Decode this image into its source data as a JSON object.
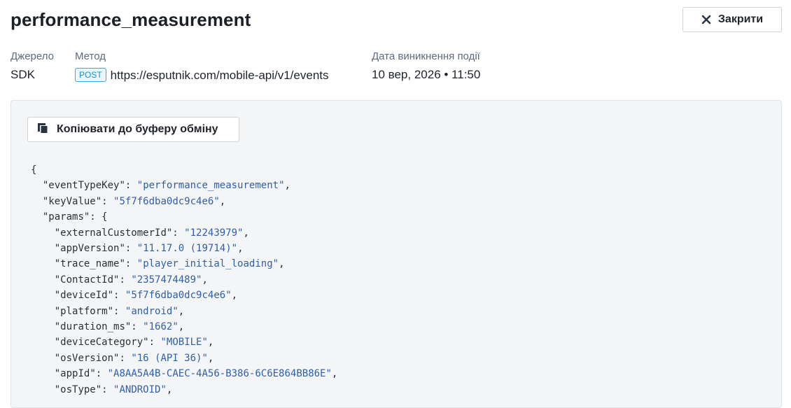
{
  "header": {
    "title": "performance_measurement",
    "close_label": "Закрити",
    "close_icon": "close-icon"
  },
  "meta": {
    "source_label": "Джерело",
    "source_value": "SDK",
    "method_label": "Метод",
    "method_badge": "POST",
    "method_url": "https://esputnik.com/mobile-api/v1/events",
    "date_label": "Дата виникнення події",
    "date_value": "10 вер, 2026 • 11:50"
  },
  "panel": {
    "copy_label": "Копіювати до буферу обміну",
    "copy_icon": "copy-icon",
    "json_lines": [
      {
        "indent": 0,
        "key": "",
        "value": "",
        "suffix": "{"
      },
      {
        "indent": 1,
        "key": "eventTypeKey",
        "value": "performance_measurement",
        "suffix": ","
      },
      {
        "indent": 1,
        "key": "keyValue",
        "value": "5f7f6dba0dc9c4e6",
        "suffix": ","
      },
      {
        "indent": 1,
        "key": "params",
        "value": "",
        "suffix": "{"
      },
      {
        "indent": 2,
        "key": "externalCustomerId",
        "value": "12243979",
        "suffix": ","
      },
      {
        "indent": 2,
        "key": "appVersion",
        "value": "11.17.0 (19714)",
        "suffix": ","
      },
      {
        "indent": 2,
        "key": "trace_name",
        "value": "player_initial_loading",
        "suffix": ","
      },
      {
        "indent": 2,
        "key": "ContactId",
        "value": "2357474489",
        "suffix": ","
      },
      {
        "indent": 2,
        "key": "deviceId",
        "value": "5f7f6dba0dc9c4e6",
        "suffix": ","
      },
      {
        "indent": 2,
        "key": "platform",
        "value": "android",
        "suffix": ","
      },
      {
        "indent": 2,
        "key": "duration_ms",
        "value": "1662",
        "suffix": ","
      },
      {
        "indent": 2,
        "key": "deviceCategory",
        "value": "MOBILE",
        "suffix": ","
      },
      {
        "indent": 2,
        "key": "osVersion",
        "value": "16 (API 36)",
        "suffix": ","
      },
      {
        "indent": 2,
        "key": "appId",
        "value": "A8AA5A4B-CAEC-4A56-B386-6C6E864BB86E",
        "suffix": ","
      },
      {
        "indent": 2,
        "key": "osType",
        "value": "ANDROID",
        "suffix": ","
      }
    ]
  },
  "colors": {
    "json_string": "#2f5fa8",
    "badge_border": "#3ea9d6",
    "panel_bg": "#f4f5f6"
  }
}
